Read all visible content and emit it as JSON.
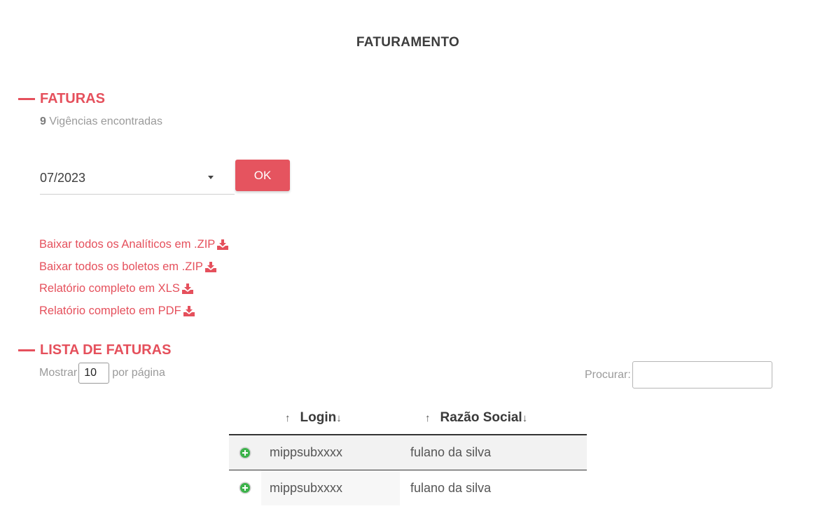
{
  "page": {
    "title": "FATURAMENTO"
  },
  "faturas": {
    "heading": "FATURAS",
    "count": "9",
    "count_text": "Vigências encontradas",
    "period_selected": "07/2023",
    "ok_label": "OK",
    "downloads": [
      {
        "label": "Baixar todos os Analíticos em .ZIP",
        "icon": "download-icon"
      },
      {
        "label": "Baixar todos os boletos em .ZIP",
        "icon": "download-icon"
      },
      {
        "label": "Relatório completo em XLS",
        "icon": "download-icon"
      },
      {
        "label": "Relatório completo em PDF",
        "icon": "download-icon"
      }
    ]
  },
  "lista": {
    "heading": "LISTA DE FATURAS",
    "show_label": "Mostrar",
    "per_page_value": "10",
    "per_page_suffix": "por página",
    "search_label": "Procurar:",
    "search_value": "",
    "columns": [
      {
        "label": "Login",
        "sort_up": "↑",
        "sort_down": "↓"
      },
      {
        "label": "Razão Social",
        "sort_up": "↑",
        "sort_down": "↓"
      }
    ],
    "rows": [
      {
        "login": "mippsubxxxx",
        "razao_social": "fulano da silva"
      },
      {
        "login": "mippsubxxxx",
        "razao_social": "fulano da silva"
      }
    ]
  },
  "colors": {
    "accent": "#e5505c",
    "expand_icon": "#3cb34a"
  }
}
